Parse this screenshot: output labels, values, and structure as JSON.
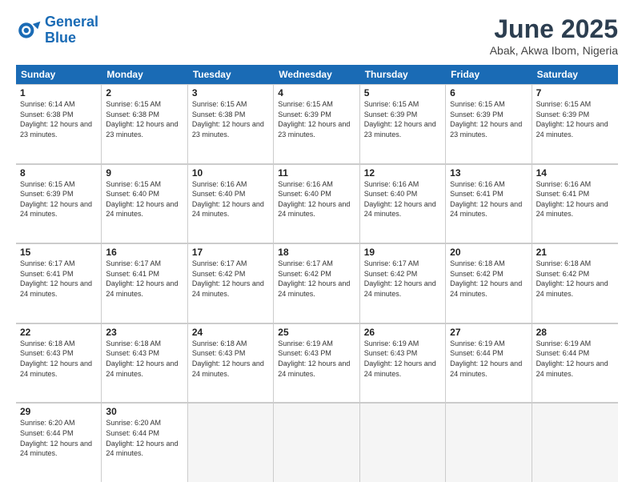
{
  "header": {
    "logo_line1": "General",
    "logo_line2": "Blue",
    "month": "June 2025",
    "location": "Abak, Akwa Ibom, Nigeria"
  },
  "days_of_week": [
    "Sunday",
    "Monday",
    "Tuesday",
    "Wednesday",
    "Thursday",
    "Friday",
    "Saturday"
  ],
  "weeks": [
    [
      {
        "day": "1",
        "sunrise": "6:14 AM",
        "sunset": "6:38 PM",
        "daylight": "12 hours and 23 minutes."
      },
      {
        "day": "2",
        "sunrise": "6:15 AM",
        "sunset": "6:38 PM",
        "daylight": "12 hours and 23 minutes."
      },
      {
        "day": "3",
        "sunrise": "6:15 AM",
        "sunset": "6:38 PM",
        "daylight": "12 hours and 23 minutes."
      },
      {
        "day": "4",
        "sunrise": "6:15 AM",
        "sunset": "6:39 PM",
        "daylight": "12 hours and 23 minutes."
      },
      {
        "day": "5",
        "sunrise": "6:15 AM",
        "sunset": "6:39 PM",
        "daylight": "12 hours and 23 minutes."
      },
      {
        "day": "6",
        "sunrise": "6:15 AM",
        "sunset": "6:39 PM",
        "daylight": "12 hours and 23 minutes."
      },
      {
        "day": "7",
        "sunrise": "6:15 AM",
        "sunset": "6:39 PM",
        "daylight": "12 hours and 24 minutes."
      }
    ],
    [
      {
        "day": "8",
        "sunrise": "6:15 AM",
        "sunset": "6:39 PM",
        "daylight": "12 hours and 24 minutes."
      },
      {
        "day": "9",
        "sunrise": "6:15 AM",
        "sunset": "6:40 PM",
        "daylight": "12 hours and 24 minutes."
      },
      {
        "day": "10",
        "sunrise": "6:16 AM",
        "sunset": "6:40 PM",
        "daylight": "12 hours and 24 minutes."
      },
      {
        "day": "11",
        "sunrise": "6:16 AM",
        "sunset": "6:40 PM",
        "daylight": "12 hours and 24 minutes."
      },
      {
        "day": "12",
        "sunrise": "6:16 AM",
        "sunset": "6:40 PM",
        "daylight": "12 hours and 24 minutes."
      },
      {
        "day": "13",
        "sunrise": "6:16 AM",
        "sunset": "6:41 PM",
        "daylight": "12 hours and 24 minutes."
      },
      {
        "day": "14",
        "sunrise": "6:16 AM",
        "sunset": "6:41 PM",
        "daylight": "12 hours and 24 minutes."
      }
    ],
    [
      {
        "day": "15",
        "sunrise": "6:17 AM",
        "sunset": "6:41 PM",
        "daylight": "12 hours and 24 minutes."
      },
      {
        "day": "16",
        "sunrise": "6:17 AM",
        "sunset": "6:41 PM",
        "daylight": "12 hours and 24 minutes."
      },
      {
        "day": "17",
        "sunrise": "6:17 AM",
        "sunset": "6:42 PM",
        "daylight": "12 hours and 24 minutes."
      },
      {
        "day": "18",
        "sunrise": "6:17 AM",
        "sunset": "6:42 PM",
        "daylight": "12 hours and 24 minutes."
      },
      {
        "day": "19",
        "sunrise": "6:17 AM",
        "sunset": "6:42 PM",
        "daylight": "12 hours and 24 minutes."
      },
      {
        "day": "20",
        "sunrise": "6:18 AM",
        "sunset": "6:42 PM",
        "daylight": "12 hours and 24 minutes."
      },
      {
        "day": "21",
        "sunrise": "6:18 AM",
        "sunset": "6:42 PM",
        "daylight": "12 hours and 24 minutes."
      }
    ],
    [
      {
        "day": "22",
        "sunrise": "6:18 AM",
        "sunset": "6:43 PM",
        "daylight": "12 hours and 24 minutes."
      },
      {
        "day": "23",
        "sunrise": "6:18 AM",
        "sunset": "6:43 PM",
        "daylight": "12 hours and 24 minutes."
      },
      {
        "day": "24",
        "sunrise": "6:18 AM",
        "sunset": "6:43 PM",
        "daylight": "12 hours and 24 minutes."
      },
      {
        "day": "25",
        "sunrise": "6:19 AM",
        "sunset": "6:43 PM",
        "daylight": "12 hours and 24 minutes."
      },
      {
        "day": "26",
        "sunrise": "6:19 AM",
        "sunset": "6:43 PM",
        "daylight": "12 hours and 24 minutes."
      },
      {
        "day": "27",
        "sunrise": "6:19 AM",
        "sunset": "6:44 PM",
        "daylight": "12 hours and 24 minutes."
      },
      {
        "day": "28",
        "sunrise": "6:19 AM",
        "sunset": "6:44 PM",
        "daylight": "12 hours and 24 minutes."
      }
    ],
    [
      {
        "day": "29",
        "sunrise": "6:20 AM",
        "sunset": "6:44 PM",
        "daylight": "12 hours and 24 minutes."
      },
      {
        "day": "30",
        "sunrise": "6:20 AM",
        "sunset": "6:44 PM",
        "daylight": "12 hours and 24 minutes."
      },
      {
        "day": "",
        "sunrise": "",
        "sunset": "",
        "daylight": ""
      },
      {
        "day": "",
        "sunrise": "",
        "sunset": "",
        "daylight": ""
      },
      {
        "day": "",
        "sunrise": "",
        "sunset": "",
        "daylight": ""
      },
      {
        "day": "",
        "sunrise": "",
        "sunset": "",
        "daylight": ""
      },
      {
        "day": "",
        "sunrise": "",
        "sunset": "",
        "daylight": ""
      }
    ]
  ]
}
